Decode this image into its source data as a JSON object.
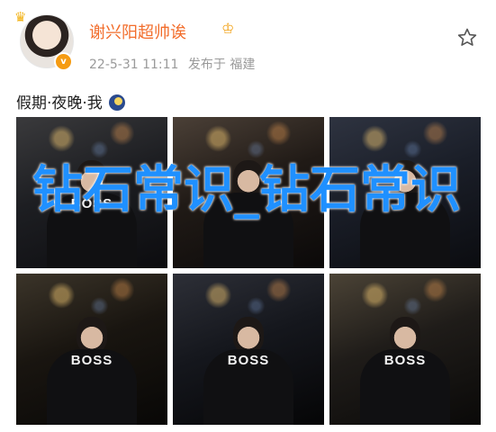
{
  "header": {
    "username": "谢兴阳超帅诶",
    "vip_icon": "crown-vip-icon",
    "verified_badge": "v",
    "timestamp": "22-5-31 11:11",
    "source": "发布于 福建",
    "avatar_icon": "avatar",
    "favorite_icon": "star-outline-icon"
  },
  "post": {
    "text": "假期·夜晚·我",
    "emoji": "moon-emoji"
  },
  "photos": [
    {
      "caption": "BOSS"
    },
    {
      "caption": ""
    },
    {
      "caption": ""
    },
    {
      "caption": "BOSS"
    },
    {
      "caption": "BOSS"
    },
    {
      "caption": "BOSS"
    }
  ],
  "watermark": {
    "text": "钻石常识_钻石常识"
  },
  "colors": {
    "username": "#f26d2b",
    "watermark": "#1f90ff",
    "meta": "#9a9a9a"
  }
}
